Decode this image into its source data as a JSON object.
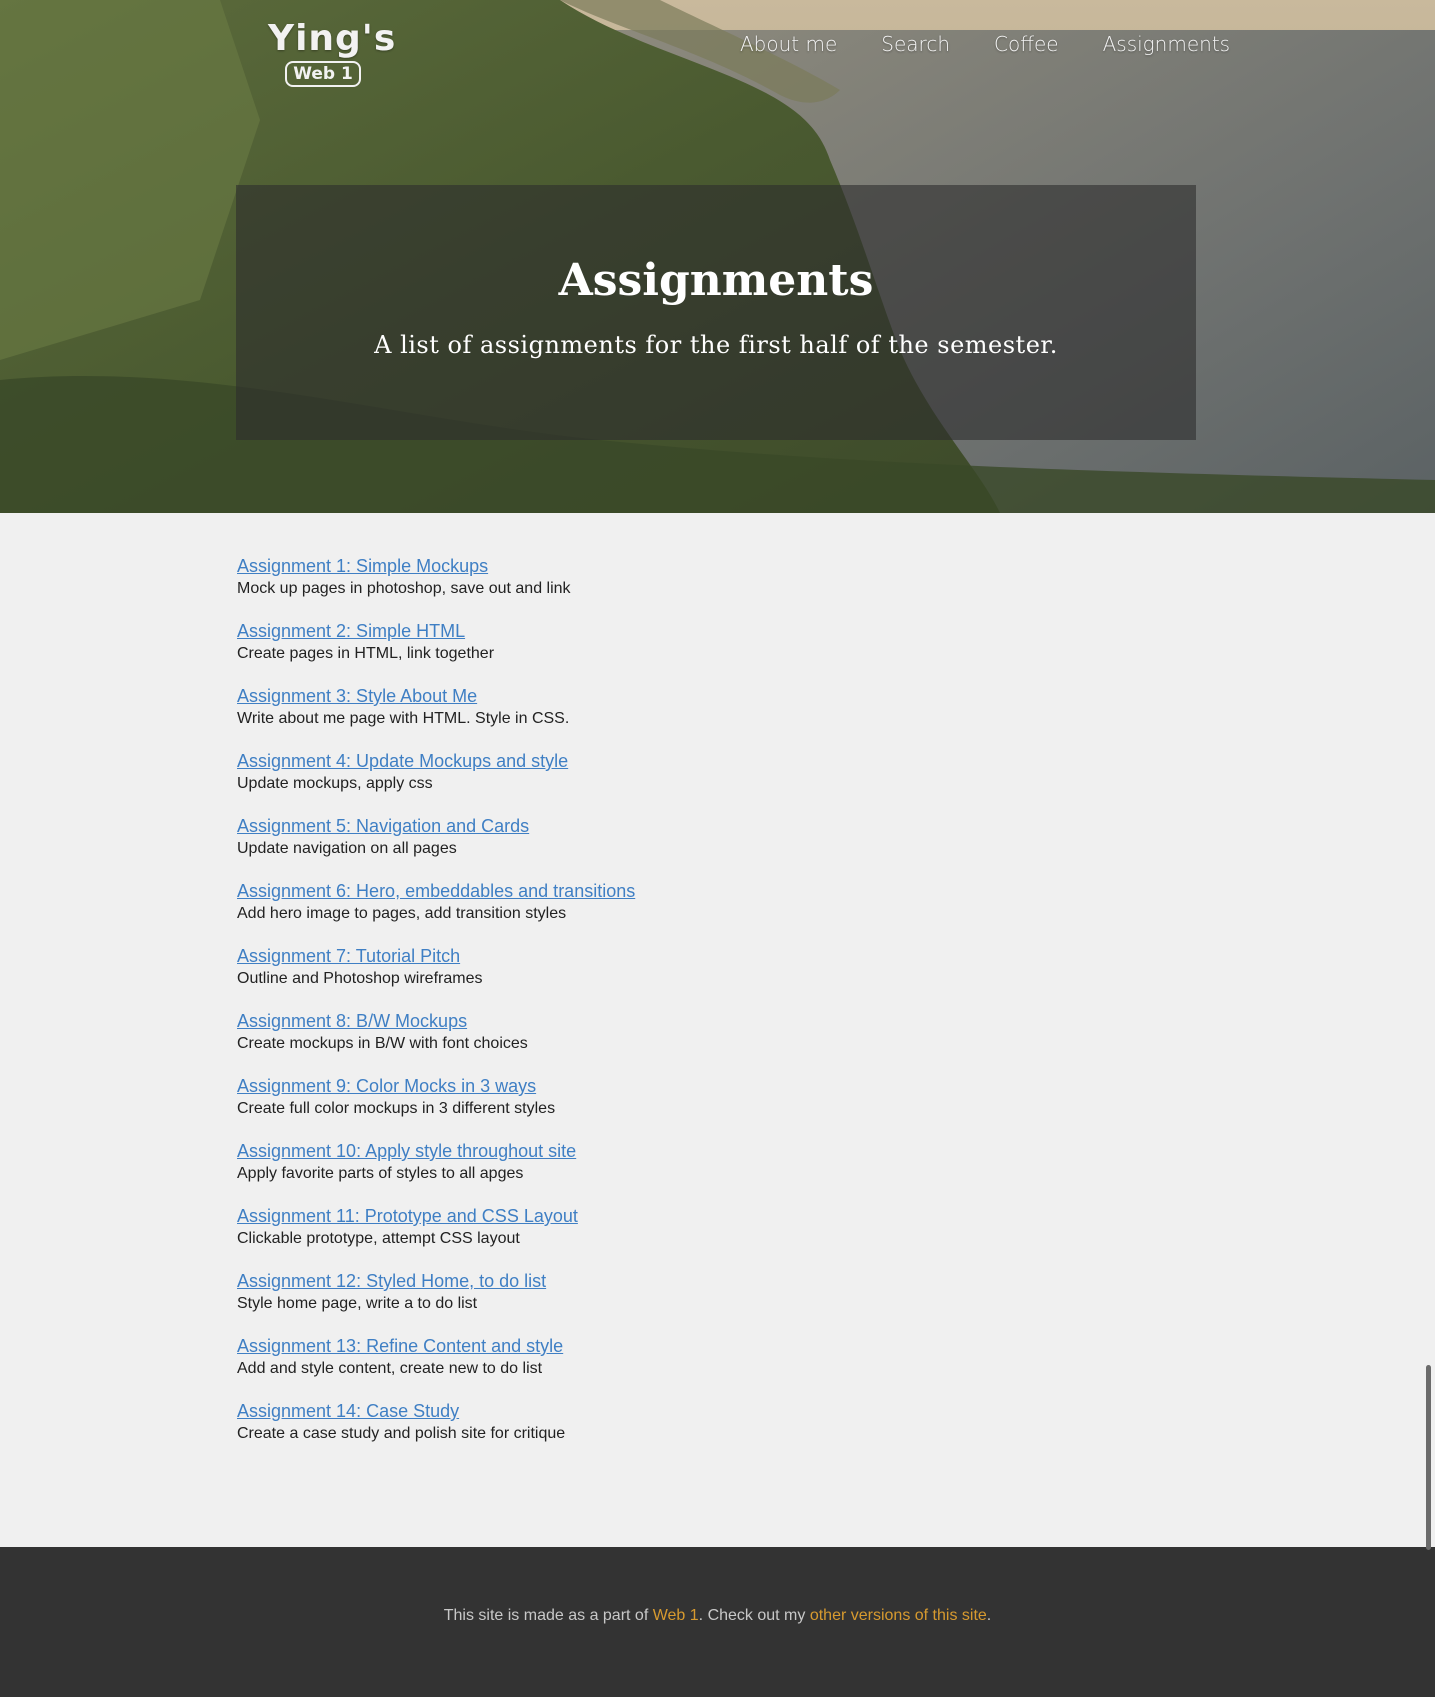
{
  "header": {
    "logo_title": "Ying's",
    "logo_badge": "Web 1",
    "nav": [
      {
        "label": "About me"
      },
      {
        "label": "Search"
      },
      {
        "label": "Coffee"
      },
      {
        "label": "Assignments"
      }
    ]
  },
  "hero": {
    "title": "Assignments",
    "subtitle": "A list of assignments for the first half of the semester."
  },
  "assignments": [
    {
      "title": "Assignment 1: Simple Mockups",
      "description": "Mock up pages in photoshop, save out and link"
    },
    {
      "title": "Assignment 2: Simple HTML",
      "description": "Create pages in HTML, link together"
    },
    {
      "title": "Assignment 3: Style About Me",
      "description": "Write about me page with HTML. Style in CSS."
    },
    {
      "title": "Assignment 4: Update Mockups and style",
      "description": "Update mockups, apply css"
    },
    {
      "title": "Assignment 5: Navigation and Cards",
      "description": "Update navigation on all pages"
    },
    {
      "title": "Assignment 6: Hero, embeddables and transitions",
      "description": "Add hero image to pages, add transition styles"
    },
    {
      "title": "Assignment 7: Tutorial Pitch",
      "description": "Outline and Photoshop wireframes"
    },
    {
      "title": "Assignment 8: B/W Mockups",
      "description": "Create mockups in B/W with font choices"
    },
    {
      "title": "Assignment 9: Color Mocks in 3 ways",
      "description": "Create full color mockups in 3 different styles"
    },
    {
      "title": "Assignment 10: Apply style throughout site",
      "description": "Apply favorite parts of styles to all apges"
    },
    {
      "title": "Assignment 11: Prototype and CSS Layout",
      "description": "Clickable prototype, attempt CSS layout"
    },
    {
      "title": "Assignment 12: Styled Home, to do list",
      "description": "Style home page, write a to do list"
    },
    {
      "title": "Assignment 13: Refine Content and style",
      "description": "Add and style content, create new to do list"
    },
    {
      "title": "Assignment 14: Case Study",
      "description": "Create a case study and polish site for critique"
    }
  ],
  "footer": {
    "text_before": "This site is made as a part of ",
    "link1": "Web 1",
    "text_middle": ". Check out my ",
    "link2": "other versions of this site",
    "text_after": "."
  },
  "colors": {
    "link": "#3f7fc4",
    "footer_bg": "#333333",
    "footer_link": "#d79a2f",
    "page_bg": "#f0f0f0"
  }
}
